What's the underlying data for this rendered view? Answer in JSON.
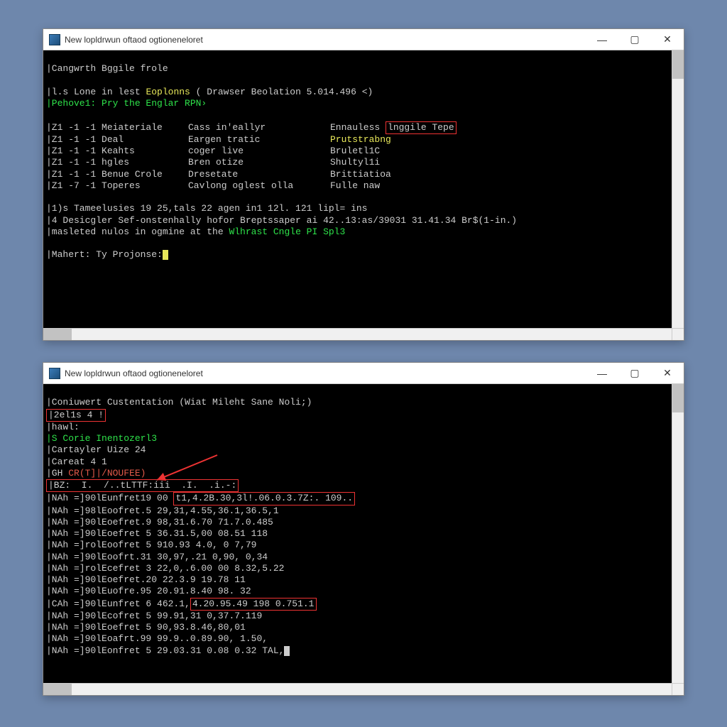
{
  "window1": {
    "title": "New lopldrwun oftaod ogtioneneloret",
    "lines": {
      "header": "|Cangwrth Bggile frole",
      "info1_a": "|l.s Lone in lest ",
      "info1_b": "Eoplonns",
      "info1_c": " ( Drawser Beolation 5.014.496 <)",
      "prompt1": "|Pehove1: Pry the Englar RPN›",
      "table_hdr_c3": "Ennauless",
      "table_hdr_c3b": "lnggile Tepe",
      "rows": [
        {
          "c0": "|Z1 -1 -1 Meiateriale",
          "c1": "Cass in'eallyr",
          "c2": ""
        },
        {
          "c0": "|Z1 -1 -1 Deal",
          "c1": "Eargen tratic",
          "c2": "Prutstrabng"
        },
        {
          "c0": "|Z1 -1 -1 Keahts",
          "c1": "coger live",
          "c2": "Bruletl1C"
        },
        {
          "c0": "|Z1 -1 -1 hgles",
          "c1": "Bren otize",
          "c2": "Shultyl1i"
        },
        {
          "c0": "|Z1 -1 -1 Benue Crole",
          "c1": "Dresetate",
          "c2": "Brittiatioa"
        },
        {
          "c0": "|Z1 -7 -1 Toperes",
          "c1": "Cavlong oglest olla",
          "c2": "Fulle naw"
        }
      ],
      "summary1": "|1)s Tameelusies 19 25,tals 22 agen in1 12l. 121 lipl= ins",
      "summary2": "|4 Desicgler Sef-onstenhally hofor Breptssaper ai 42..13:as/39031 31.41.34 Br$(1-in.)",
      "summary3a": "|masleted nulos in ogmine at the ",
      "summary3b": "Wlhrast Cngle PI Spl3",
      "prompt2": "|Mahert: Ty Projonse:"
    }
  },
  "window2": {
    "title": "New lopldrwun oftaod ogtioneneloret",
    "lines": {
      "l0": "|Coniuwert Custentation (Wiat Mileht Sane Noli;)",
      "l1_box": "|2el1s 4 !",
      "l2": "|hawl:",
      "l3_green": "|S Corie Inentozerl3",
      "l4": "|Cartayler Uize 24",
      "l5": "|Careat 4 1",
      "l6a": "|GH ",
      "l6b": "CR(T]|/NOUFEE)",
      "l7_box": "|BZ:  I.  /..tLTTF:iii  .I.  .i.-:",
      "l8a": "|NAh =]90lEunfret19 00 ",
      "l8b": "t1,4.2B.30,3l!.06.0.3.7Z:. 109..",
      "l9": "|NAh =]98lEoofret.5 29,31,4.55,36.1,36.5,1",
      "l10": "|NAh =]90lEoefret.9 98,31.6.70 71.7.0.485",
      "l11": "|NAh =]90lEoefret 5 36.31.5,00 08.51 118",
      "l12": "|NAh =]rolEoofret 5 910.93 4.0, 0 7,79",
      "l13": "|NAh =]90lEoofrt.31 30,97,.21 0,90, 0,34",
      "l14": "|NAh =]rolEcefret 3 22,0,.6.00 00 8.32,5.22",
      "l15": "|NAh =]90lEoefret.20 22.3.9 19.78 11",
      "l16": "|NAh =]90lEuofre.95 20.91.8.40 98. 32",
      "l17a": "|CAh =]90lEunfret 6 462.1",
      "l17b": "4.20.95.49 198 0.751.1",
      "l18": "|NAh =]90lEcofret 5 99.91,31 0,37.7.119",
      "l19": "|NAh =]90lEoefret 5 90,93.8.46,80,01",
      "l20": "|NAh =]90lEoafrt.99 99.9..0.89.90, 1.50,",
      "l21": "|NAh =]90lEonfret 5 29.03.31 0.08 0.32 TAL,"
    }
  }
}
